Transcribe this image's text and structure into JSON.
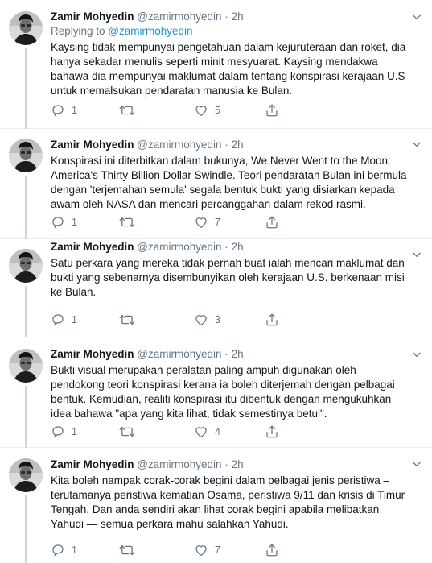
{
  "tweets": [
    {
      "name": "Zamir Mohyedin",
      "handle": "@zamirmohyedin",
      "sep": "·",
      "time": "2h",
      "replying_prefix": "Replying to",
      "replying_to": "@zamirmohyedin",
      "text": "Kaysing tidak mempunyai pengetahuan dalam kejuruteraan dan roket, dia hanya sekadar menulis seperti minit mesyuarat. Kaysing mendakwa bahawa dia mempunyai maklumat dalam tentang konspirasi kerajaan U.S untuk memalsukan pendaratan manusia ke Bulan.",
      "replies": "1",
      "retweets": "",
      "likes": "5"
    },
    {
      "name": "Zamir Mohyedin",
      "handle": "@zamirmohyedin",
      "sep": "·",
      "time": "2h",
      "text": "Konspirasi ini diterbitkan dalam bukunya, We Never Went to the Moon: America's Thirty Billion Dollar Swindle. Teori pendaratan Bulan ini bermula dengan 'terjemahan semula' segala bentuk bukti yang disiarkan kepada awam oleh NASA dan mencari percanggahan dalam rekod rasmi.",
      "replies": "1",
      "retweets": "",
      "likes": "7"
    },
    {
      "name": "Zamir Mohyedin",
      "handle": "@zamirmohyedin",
      "sep": "·",
      "time": "2h",
      "text": "Satu perkara yang mereka tidak pernah buat ialah mencari maklumat dan bukti yang sebenarnya disembunyikan oleh kerajaan U.S. berkenaan misi ke Bulan.",
      "replies": "1",
      "retweets": "",
      "likes": "3"
    },
    {
      "name": "Zamir Mohyedin",
      "handle": "@zamirmohyedin",
      "sep": "·",
      "time": "2h",
      "text": "Bukti visual merupakan peralatan paling ampuh digunakan oleh pendokong teori konspirasi kerana ia boleh diterjemah dengan pelbagai bentuk. Kemudian, realiti konspirasi itu dibentuk dengan mengukuhkan idea bahawa \"apa yang kita lihat, tidak semestinya betul\".",
      "replies": "1",
      "retweets": "",
      "likes": "4"
    },
    {
      "name": "Zamir Mohyedin",
      "handle": "@zamirmohyedin",
      "sep": "·",
      "time": "2h",
      "text": "Kita boleh nampak corak-corak begini dalam pelbagai jenis peristiwa – terutamanya peristiwa kematian Osama, peristiwa 9/11 dan krisis di Timur Tengah. Dan anda sendiri akan lihat corak begini apabila melibatkan Yahudi — semua perkara mahu salahkan Yahudi.",
      "replies": "1",
      "retweets": "",
      "likes": "7"
    }
  ],
  "icons": {
    "reply": "reply-icon",
    "retweet": "retweet-icon",
    "like": "like-icon",
    "share": "share-icon",
    "more": "chevron-down-icon"
  },
  "colors": {
    "secondary_text": "#657786",
    "link": "#1b95e0",
    "thread_line": "#ccd6dd",
    "divider": "#e6ecf0"
  }
}
